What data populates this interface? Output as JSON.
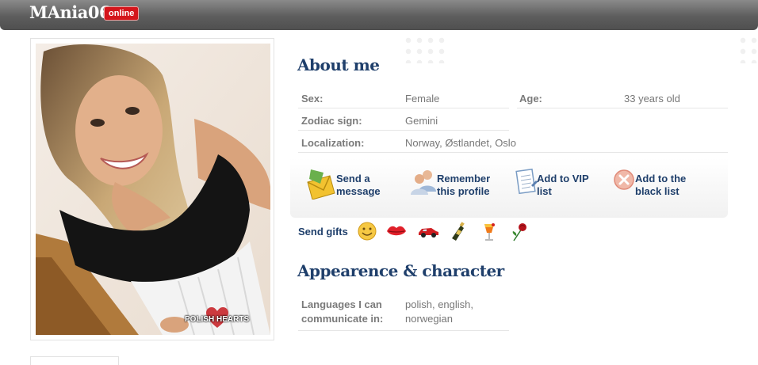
{
  "header": {
    "username": "MAnia06",
    "status": "online"
  },
  "photo": {
    "watermark": "POLISH HEARTS"
  },
  "about": {
    "title": "About me",
    "rows": [
      {
        "label": "Sex:",
        "value": "Female"
      },
      {
        "label": "Age:",
        "value": "33 years old"
      },
      {
        "label": "Zodiac sign:",
        "value": "Gemini"
      },
      {
        "label": "Localization:",
        "value": "Norway, Østlandet, Oslo"
      }
    ]
  },
  "actions": [
    {
      "line1": "Send a",
      "line2": "message",
      "icon": "envelope-icon"
    },
    {
      "line1": "Remember",
      "line2": "this profile",
      "icon": "users-icon"
    },
    {
      "line1": "Add to VIP",
      "line2": "list",
      "icon": "notepad-icon"
    },
    {
      "line1": "Add to the",
      "line2": "black list",
      "icon": "block-icon"
    }
  ],
  "gifts": {
    "label": "Send gifts",
    "items": [
      "smiley-icon",
      "lips-icon",
      "car-icon",
      "champagne-icon",
      "cocktail-icon",
      "rose-icon"
    ]
  },
  "character": {
    "title": "Appearence & character",
    "rows": [
      {
        "label_line1": "Languages I can",
        "label_line2": "communicate in:",
        "value_line1": "polish, english,",
        "value_line2": "norwegian"
      }
    ]
  },
  "colors": {
    "accent": "#1f3f6b",
    "badge": "#d4151b",
    "header": "#5d5d5d"
  }
}
